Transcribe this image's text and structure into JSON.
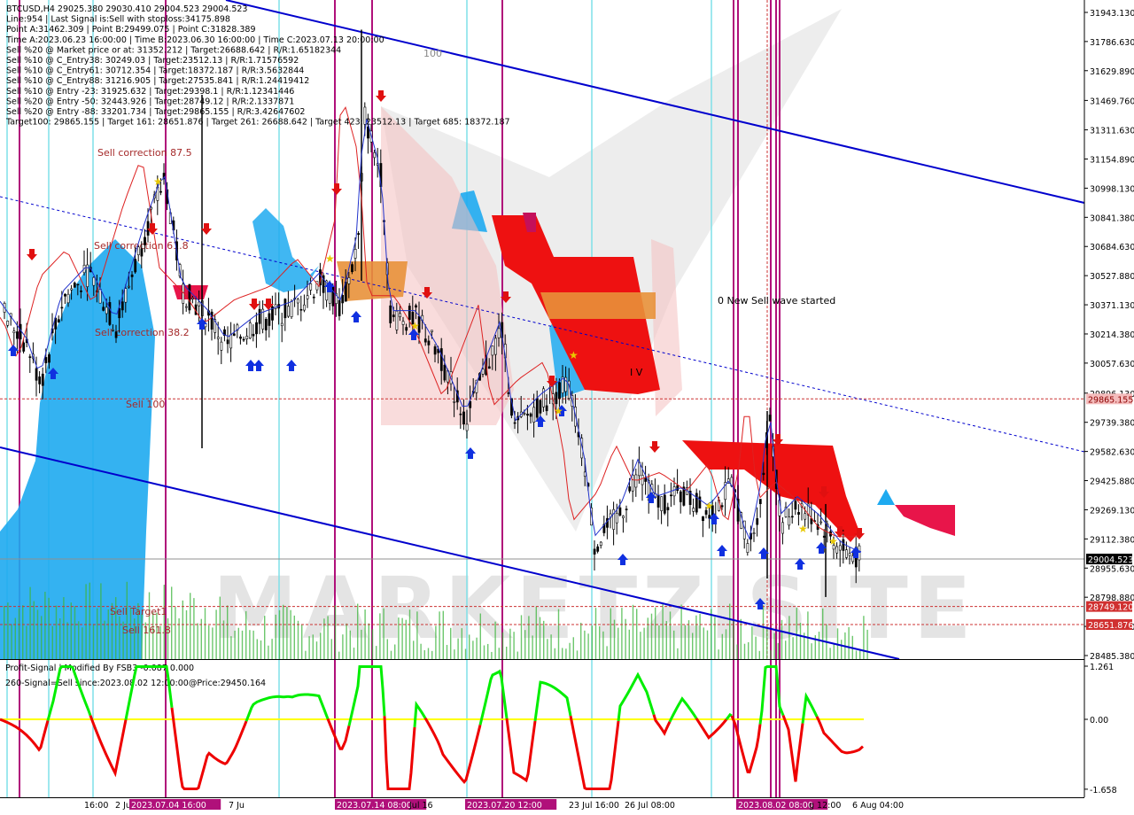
{
  "header": {
    "info_lines": [
      "BTCUSD,H4  29025.380 29030.410 29004.523 29004.523",
      "Line:954 | Last Signal is:Sell with stoploss:34175.898",
      "Point A:31462.309 | Point B:29499.075 | Point C:31828.389",
      "Time A:2023.06.23 16:00:00 | Time B:2023.06.30 16:00:00 | Time C:2023.07.13 20:00:00",
      "Sell %20 @ Market price or at: 31352.212 | Target:26688.642 | R/R:1.65182344",
      "Sell %10 @ C_Entry38: 30249.03 | Target:23512.13 | R/R:1.71576592",
      "Sell %10 @ C_Entry61: 30712.354 | Target:18372.187 | R/R:3.5632844",
      "Sell %10 @ C_Entry88: 31216.905 | Target:27535.841 | R/R:1.24419412",
      "Sell %10 @ Entry -23: 31925.632 | Target:29398.1 | R/R:1.12341446",
      "Sell %20 @ Entry -50: 32443.926 | Target:28749.12 | R/R:2.1337871",
      "Sell %20 @ Entry -88: 33201.734 | Target:29865.155 | R/R:3.42647602",
      "Target100: 29865.155 | Target 161: 28651.876 | Target 261: 26688.642 | Target 423: 23512.13 | Target 685: 18372.187"
    ]
  },
  "chart_data": [
    {
      "type": "candlestick",
      "symbol": "BTCUSD",
      "timeframe": "H4",
      "ohlc_last": {
        "open": 29025.38,
        "high": 29030.41,
        "low": 29004.523,
        "close": 29004.523
      },
      "y_ticks": [
        31943.13,
        31786.63,
        31629.89,
        31469.76,
        31311.63,
        31154.89,
        30998.13,
        30841.38,
        30684.63,
        30527.88,
        30371.13,
        30214.38,
        30057.63,
        29896.13,
        29739.38,
        29582.63,
        29425.88,
        29269.13,
        29112.38,
        28955.63,
        28798.88,
        28642.13,
        28485.38
      ],
      "y_tick_labels": [
        "31943.130",
        "31786.630",
        "31629.890",
        "31469.760",
        "31311.630",
        "31154.890",
        "30998.130",
        "30841.380",
        "30684.630",
        "30527.880",
        "30371.130",
        "30214.380",
        "30057.630",
        "29896.130",
        "29739.380",
        "29582.630",
        "29425.880",
        "29269.130",
        "29112.380",
        "28955.630",
        "28798.880",
        "28642.130",
        "28485.380"
      ],
      "ylim": [
        28455,
        31988
      ],
      "price_boxes": [
        {
          "label": "29865.155",
          "value": 29865.155,
          "color": "#f4bcbc",
          "text_color": "#8b0000"
        },
        {
          "label": "29004.523",
          "value": 29004.523,
          "color": "#000000",
          "text_color": "#ffffff"
        },
        {
          "label": "28749.120",
          "value": 28749.12,
          "color": "#d03030",
          "text_color": "#ffffff"
        },
        {
          "label": "28651.876",
          "value": 28651.876,
          "color": "#d03030",
          "text_color": "#ffffff"
        }
      ],
      "levels": [
        {
          "label": "Sell correction 87.5",
          "value": 31154
        },
        {
          "label": "Sell correction 61.8",
          "value": 30640
        },
        {
          "label": "Sell correction 38.2",
          "value": 30214
        },
        {
          "label": "Sell 100",
          "value": 29865.155
        },
        {
          "label": "Sell Target1",
          "value": 28749.12
        },
        {
          "label": "Sell 161.8",
          "value": 28651.876
        }
      ],
      "annotations": [
        "100",
        "0 New Sell wave started",
        "I V"
      ],
      "watermark": "MARKETZISITE"
    },
    {
      "type": "line",
      "title_lines": [
        "Profit-Signal | Modified By FSB3 -0.087 0.000",
        "260-Signal=Sell since:2023.08.02 12:00:00@Price:29450.164"
      ],
      "y_tick_labels": [
        "1.261",
        "0.00",
        "-1.658"
      ],
      "y_ticks": [
        1.261,
        0.0,
        -1.658
      ],
      "ylim": [
        -1.75,
        1.4
      ],
      "zero_line_color": "#ffff00",
      "up_color": "#00ee00",
      "down_color": "#ee0000"
    }
  ],
  "x_axis": {
    "tick_labels": [
      "16:00",
      "2 Jul",
      "2023.07.04 16:00",
      "7 Ju",
      "2023.07.14 08:00",
      "Jul 16",
      "2023.07.20 12:00",
      "23 Jul 16:00",
      "26 Jul 08:00",
      "2023.08.02 08:00",
      "g 12:00",
      "6 Aug 04:00"
    ],
    "highlighted": [
      "2023.07.04 16:00",
      "2023.07.14 08:00",
      "2023.07.20 12:00",
      "2023.08.02 08:00"
    ]
  },
  "colors": {
    "uptrend_line": "#0000cd",
    "signal_vertical": "#b0107a",
    "cyan_vertical": "#7fe0e8",
    "cloud_blue": "#1eaaf0",
    "cloud_red": "#ee1111"
  }
}
